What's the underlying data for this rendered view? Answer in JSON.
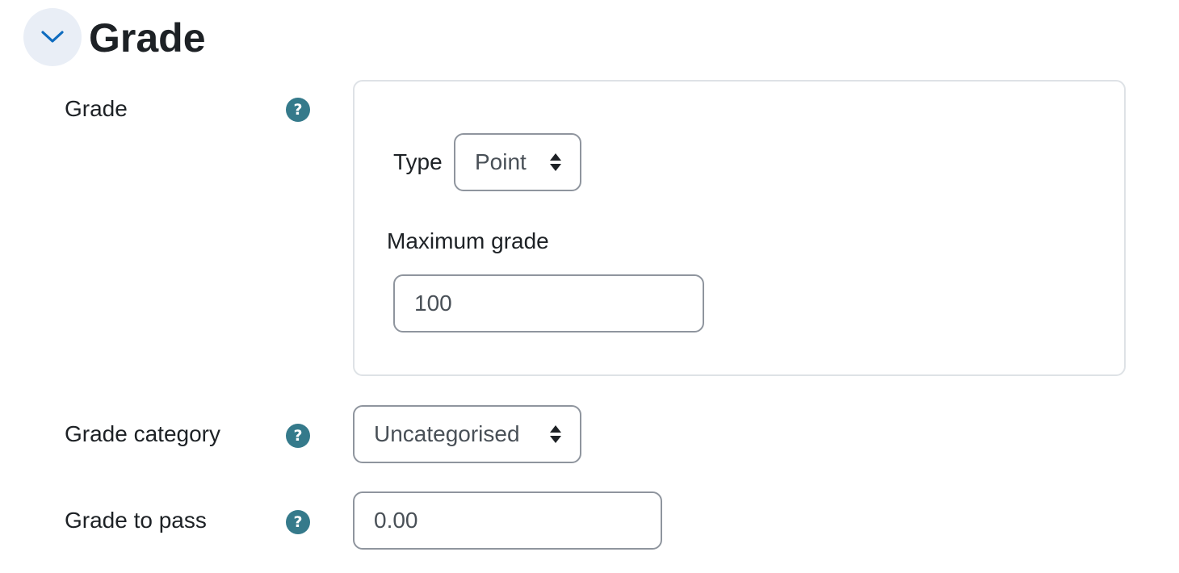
{
  "section": {
    "title": "Grade",
    "collapse_icon": "chevron-down-icon"
  },
  "grade": {
    "label": "Grade",
    "help": "?",
    "type_label": "Type",
    "type_value": "Point",
    "max_grade_label": "Maximum grade",
    "max_grade_value": "100"
  },
  "grade_category": {
    "label": "Grade category",
    "help": "?",
    "value": "Uncategorised"
  },
  "grade_to_pass": {
    "label": "Grade to pass",
    "help": "?",
    "value": "0.00"
  },
  "colors": {
    "help_icon": "#357a8b",
    "collapse_bg": "#e9eef6",
    "chevron": "#0f6cbf",
    "border": "#8f959e",
    "group_border": "#dee2e6"
  }
}
